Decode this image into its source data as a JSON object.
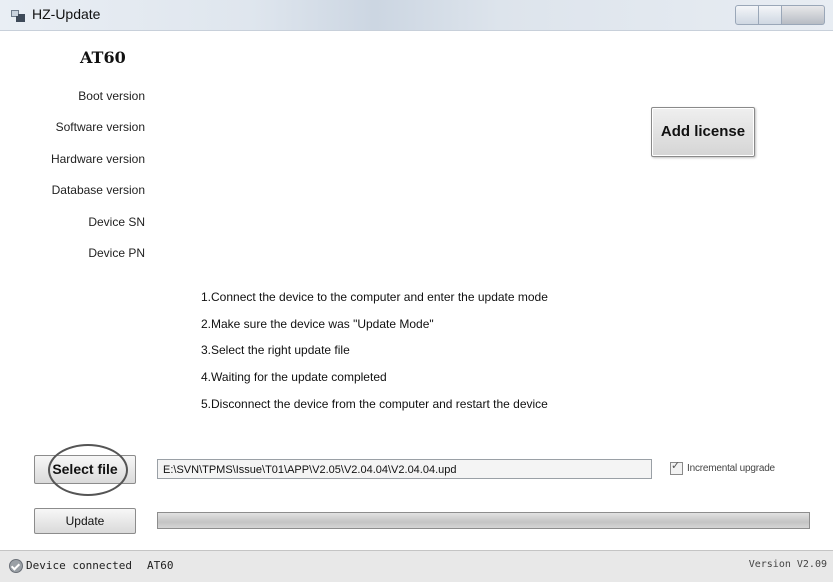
{
  "window": {
    "title": "HZ-Update"
  },
  "device": {
    "name": "AT60"
  },
  "info_labels": [
    "Boot  version",
    "Software version",
    "Hardware version",
    "Database version",
    "Device SN",
    "Device PN"
  ],
  "license": {
    "label": "Add license"
  },
  "steps": [
    "1.Connect the device to the computer and enter the update mode",
    "2.Make sure the device was \"Update Mode\"",
    "3.Select the right update file",
    "4.Waiting for the update completed",
    "5.Disconnect the device from the computer and restart the device"
  ],
  "file": {
    "select_label": "Select file",
    "path": "E:\\SVN\\TPMS\\Issue\\T01\\APP\\V2.05\\V2.04.04\\V2.04.04.upd"
  },
  "incremental": {
    "label": "Incremental upgrade",
    "checked": true
  },
  "update": {
    "label": "Update",
    "progress": 1.0
  },
  "status": {
    "text": "Device connected",
    "device": "AT60",
    "version": "Version V2.09"
  }
}
